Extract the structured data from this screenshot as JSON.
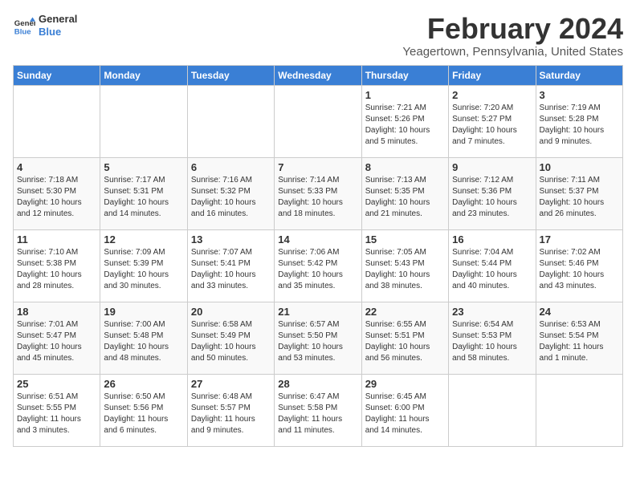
{
  "logo": {
    "text_general": "General",
    "text_blue": "Blue"
  },
  "title": "February 2024",
  "subtitle": "Yeagertown, Pennsylvania, United States",
  "days_of_week": [
    "Sunday",
    "Monday",
    "Tuesday",
    "Wednesday",
    "Thursday",
    "Friday",
    "Saturday"
  ],
  "weeks": [
    [
      {
        "day": "",
        "info": ""
      },
      {
        "day": "",
        "info": ""
      },
      {
        "day": "",
        "info": ""
      },
      {
        "day": "",
        "info": ""
      },
      {
        "day": "1",
        "info": "Sunrise: 7:21 AM\nSunset: 5:26 PM\nDaylight: 10 hours\nand 5 minutes."
      },
      {
        "day": "2",
        "info": "Sunrise: 7:20 AM\nSunset: 5:27 PM\nDaylight: 10 hours\nand 7 minutes."
      },
      {
        "day": "3",
        "info": "Sunrise: 7:19 AM\nSunset: 5:28 PM\nDaylight: 10 hours\nand 9 minutes."
      }
    ],
    [
      {
        "day": "4",
        "info": "Sunrise: 7:18 AM\nSunset: 5:30 PM\nDaylight: 10 hours\nand 12 minutes."
      },
      {
        "day": "5",
        "info": "Sunrise: 7:17 AM\nSunset: 5:31 PM\nDaylight: 10 hours\nand 14 minutes."
      },
      {
        "day": "6",
        "info": "Sunrise: 7:16 AM\nSunset: 5:32 PM\nDaylight: 10 hours\nand 16 minutes."
      },
      {
        "day": "7",
        "info": "Sunrise: 7:14 AM\nSunset: 5:33 PM\nDaylight: 10 hours\nand 18 minutes."
      },
      {
        "day": "8",
        "info": "Sunrise: 7:13 AM\nSunset: 5:35 PM\nDaylight: 10 hours\nand 21 minutes."
      },
      {
        "day": "9",
        "info": "Sunrise: 7:12 AM\nSunset: 5:36 PM\nDaylight: 10 hours\nand 23 minutes."
      },
      {
        "day": "10",
        "info": "Sunrise: 7:11 AM\nSunset: 5:37 PM\nDaylight: 10 hours\nand 26 minutes."
      }
    ],
    [
      {
        "day": "11",
        "info": "Sunrise: 7:10 AM\nSunset: 5:38 PM\nDaylight: 10 hours\nand 28 minutes."
      },
      {
        "day": "12",
        "info": "Sunrise: 7:09 AM\nSunset: 5:39 PM\nDaylight: 10 hours\nand 30 minutes."
      },
      {
        "day": "13",
        "info": "Sunrise: 7:07 AM\nSunset: 5:41 PM\nDaylight: 10 hours\nand 33 minutes."
      },
      {
        "day": "14",
        "info": "Sunrise: 7:06 AM\nSunset: 5:42 PM\nDaylight: 10 hours\nand 35 minutes."
      },
      {
        "day": "15",
        "info": "Sunrise: 7:05 AM\nSunset: 5:43 PM\nDaylight: 10 hours\nand 38 minutes."
      },
      {
        "day": "16",
        "info": "Sunrise: 7:04 AM\nSunset: 5:44 PM\nDaylight: 10 hours\nand 40 minutes."
      },
      {
        "day": "17",
        "info": "Sunrise: 7:02 AM\nSunset: 5:46 PM\nDaylight: 10 hours\nand 43 minutes."
      }
    ],
    [
      {
        "day": "18",
        "info": "Sunrise: 7:01 AM\nSunset: 5:47 PM\nDaylight: 10 hours\nand 45 minutes."
      },
      {
        "day": "19",
        "info": "Sunrise: 7:00 AM\nSunset: 5:48 PM\nDaylight: 10 hours\nand 48 minutes."
      },
      {
        "day": "20",
        "info": "Sunrise: 6:58 AM\nSunset: 5:49 PM\nDaylight: 10 hours\nand 50 minutes."
      },
      {
        "day": "21",
        "info": "Sunrise: 6:57 AM\nSunset: 5:50 PM\nDaylight: 10 hours\nand 53 minutes."
      },
      {
        "day": "22",
        "info": "Sunrise: 6:55 AM\nSunset: 5:51 PM\nDaylight: 10 hours\nand 56 minutes."
      },
      {
        "day": "23",
        "info": "Sunrise: 6:54 AM\nSunset: 5:53 PM\nDaylight: 10 hours\nand 58 minutes."
      },
      {
        "day": "24",
        "info": "Sunrise: 6:53 AM\nSunset: 5:54 PM\nDaylight: 11 hours\nand 1 minute."
      }
    ],
    [
      {
        "day": "25",
        "info": "Sunrise: 6:51 AM\nSunset: 5:55 PM\nDaylight: 11 hours\nand 3 minutes."
      },
      {
        "day": "26",
        "info": "Sunrise: 6:50 AM\nSunset: 5:56 PM\nDaylight: 11 hours\nand 6 minutes."
      },
      {
        "day": "27",
        "info": "Sunrise: 6:48 AM\nSunset: 5:57 PM\nDaylight: 11 hours\nand 9 minutes."
      },
      {
        "day": "28",
        "info": "Sunrise: 6:47 AM\nSunset: 5:58 PM\nDaylight: 11 hours\nand 11 minutes."
      },
      {
        "day": "29",
        "info": "Sunrise: 6:45 AM\nSunset: 6:00 PM\nDaylight: 11 hours\nand 14 minutes."
      },
      {
        "day": "",
        "info": ""
      },
      {
        "day": "",
        "info": ""
      }
    ]
  ]
}
